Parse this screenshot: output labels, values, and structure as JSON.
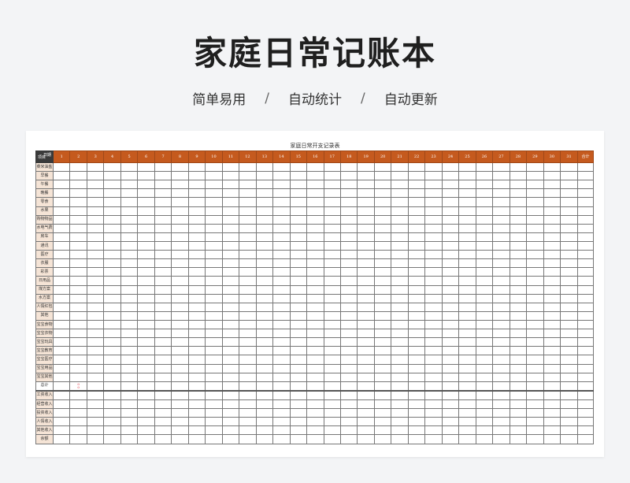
{
  "header": {
    "title": "家庭日常记账本",
    "features": [
      "简单易用",
      "自动统计",
      "自动更新"
    ],
    "separator": "/"
  },
  "sheet": {
    "title": "家庭日常开支记录表",
    "corner_top": "日期",
    "corner_bottom": "项目",
    "sum_label": "合计",
    "days": [
      "1",
      "2",
      "3",
      "4",
      "5",
      "6",
      "7",
      "8",
      "9",
      "10",
      "11",
      "12",
      "13",
      "14",
      "15",
      "16",
      "17",
      "18",
      "19",
      "20",
      "21",
      "22",
      "23",
      "24",
      "25",
      "26",
      "27",
      "28",
      "29",
      "30",
      "31"
    ],
    "expense_rows": [
      "菜米油盐",
      "早餐",
      "午餐",
      "晚餐",
      "零食",
      "水果",
      "购物物品",
      "水电气费",
      "房车",
      "通讯",
      "医疗",
      "衣服",
      "彩票",
      "日用品",
      "煤方案",
      "水方案",
      "人情红包",
      "其他",
      "宝宝食物",
      "宝宝衣物",
      "宝宝玩具",
      "宝宝教育",
      "宝宝医疗",
      "宝宝用品",
      "宝宝其他"
    ],
    "total_row": "总计",
    "total_marks": [
      "0",
      "0"
    ],
    "income_rows": [
      "工资收入",
      "经营收入",
      "投资收入",
      "人情收入",
      "其他收入",
      "余额"
    ]
  },
  "colors": {
    "header_bg": "#c55a1e",
    "corner_bg": "#3a3a3a",
    "label_bg": "#f5e4d6"
  }
}
